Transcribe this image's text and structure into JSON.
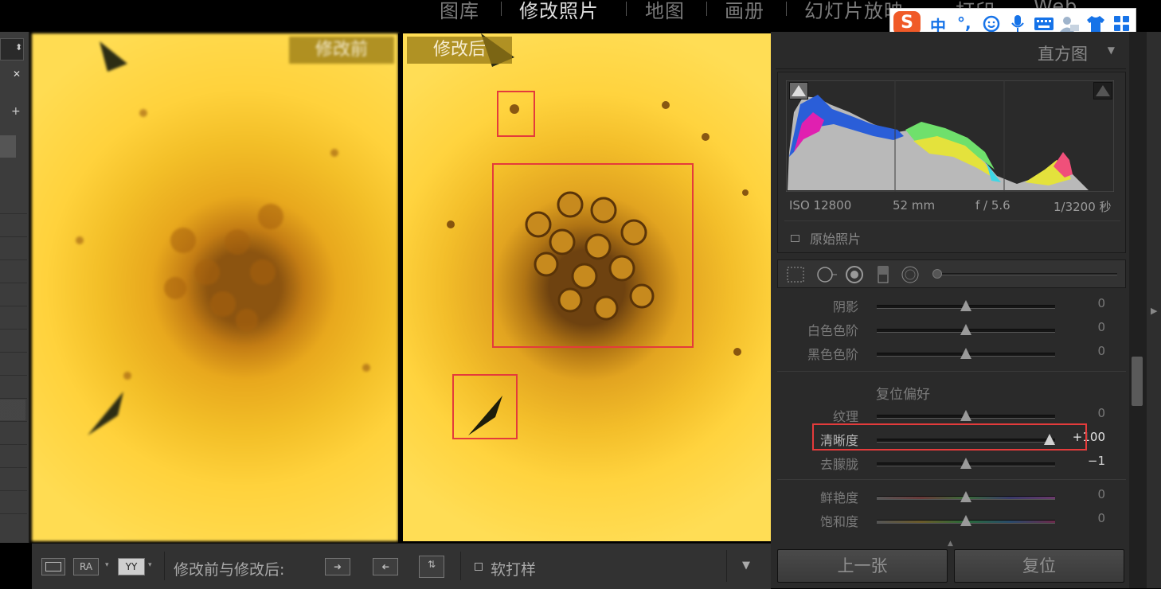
{
  "modules": [
    {
      "label": "图库",
      "active": false
    },
    {
      "label": "修改照片",
      "active": true
    },
    {
      "label": "地图",
      "active": false
    },
    {
      "label": "画册",
      "active": false
    },
    {
      "label": "幻灯片放映",
      "active": false
    },
    {
      "label": "打印",
      "active": false
    },
    {
      "label": "Web",
      "active": false
    }
  ],
  "ime": {
    "logo": "S",
    "lang": "中",
    "punct": "°,"
  },
  "photos": {
    "before_label": "修改前",
    "after_label": "修改后"
  },
  "bottombar": {
    "view_ra": "RA",
    "view_yy": "YY",
    "compare_label": "修改前与修改后:",
    "soft_proof_label": "软打样"
  },
  "histogram": {
    "title": "直方图",
    "iso": "ISO 12800",
    "focal": "52 mm",
    "aperture": "f / 5.6",
    "shutter": "1/3200 秒",
    "original_photo_label": "原始照片"
  },
  "tone": {
    "shadows": {
      "label": "阴影",
      "value": "0",
      "pos": 0.5
    },
    "whites": {
      "label": "白色色阶",
      "value": "0",
      "pos": 0.5
    },
    "blacks": {
      "label": "黑色色阶",
      "value": "0",
      "pos": 0.5
    }
  },
  "presence": {
    "title": "复位偏好",
    "texture": {
      "label": "纹理",
      "value": "0",
      "pos": 0.5
    },
    "clarity": {
      "label": "清晰度",
      "value": "+100",
      "pos": 1.0
    },
    "dehaze": {
      "label": "去朦胧",
      "value": "−1",
      "pos": 0.5
    },
    "vibrance": {
      "label": "鲜艳度",
      "value": "0",
      "pos": 0.5
    },
    "saturation": {
      "label": "饱和度",
      "value": "0",
      "pos": 0.5
    }
  },
  "footer": {
    "prev": "上一张",
    "reset": "复位"
  },
  "colors": {
    "accent_red": "#e43b3b",
    "panel": "#2a2a2a"
  }
}
